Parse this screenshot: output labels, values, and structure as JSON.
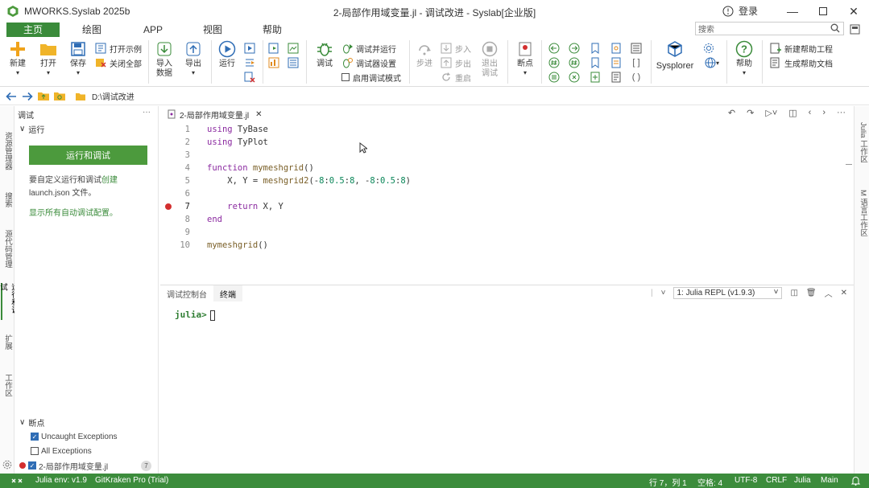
{
  "titlebar": {
    "app_title": "MWORKS.Syslab 2025b",
    "doc_title": "2-局部作用域变量.jl - 调试改进 - Syslab[企业版]",
    "login": "登录"
  },
  "ribbon_tabs": [
    "主页",
    "绘图",
    "APP",
    "视图",
    "帮助"
  ],
  "search": {
    "placeholder": "搜索"
  },
  "ribbon": {
    "new": "新建",
    "open": "打开",
    "save": "保存",
    "open_example": "打开示例",
    "close_all": "关闭全部",
    "import_data": "导入\n数据",
    "export": "导出",
    "run": "运行",
    "debug": "调试",
    "debug_run_to": "调试并运行",
    "debugger_settings": "调试器设置",
    "just_my_code": "启用调试模式",
    "step": "步进",
    "step_in": "步入",
    "step_out": "步出",
    "restart": "重启",
    "exit_debug": "退出\n调试",
    "breakpoints": "断点",
    "sysplorer": "Sysplorer",
    "help": "帮助",
    "new_help_project": "新建帮助工程",
    "gen_help_doc": "生成帮助文档"
  },
  "pathbar": {
    "path": "D:\\调试改进"
  },
  "activity_tabs": [
    "资源管理器",
    "搜索",
    "源代码管理",
    "运行和调试",
    "扩展",
    "工作区"
  ],
  "sidepanel": {
    "header": "调试",
    "section_run": "运行",
    "run_debug_button": "运行和调试",
    "text1_a": "要自定义运行和调试",
    "text1_link": "创建",
    "text1_b": "launch.json 文件。",
    "text2": "显示所有自动调试配置。",
    "section_breakpoints": "断点",
    "bp_uncaught": "Uncaught Exceptions",
    "bp_all": "All Exceptions",
    "bp_file": "2-局部作用域变量.jl",
    "bp_file_count": "7"
  },
  "editor": {
    "tab_label": "2-局部作用域变量.jl",
    "lines": [
      {
        "n": "1",
        "html": "<span class='kw'>using</span> TyBase"
      },
      {
        "n": "2",
        "html": "<span class='kw'>using</span> TyPlot"
      },
      {
        "n": "3",
        "html": ""
      },
      {
        "n": "4",
        "html": "<span class='kw'>function</span> <span class='fn'>mymeshgrid</span>()"
      },
      {
        "n": "5",
        "html": "    X, Y = <span class='fn'>meshgrid2</span>(-<span class='num'>8</span>:<span class='num'>0.5</span>:<span class='num'>8</span>, -<span class='num'>8</span>:<span class='num'>0.5</span>:<span class='num'>8</span>)"
      },
      {
        "n": "6",
        "html": ""
      },
      {
        "n": "7",
        "html": "    <span class='kw'>return</span> X, Y",
        "breakpoint": true
      },
      {
        "n": "8",
        "html": "<span class='kw'>end</span>"
      },
      {
        "n": "9",
        "html": ""
      },
      {
        "n": "10",
        "html": "<span class='fn'>mymeshgrid</span>()"
      }
    ]
  },
  "panel": {
    "tabs": [
      "调试控制台",
      "终端"
    ],
    "terminal_select": "1: Julia REPL (v1.9.3)",
    "prompt": "julia>"
  },
  "right_tabs": [
    "Julia 工作区",
    "M 语言工作区"
  ],
  "status": {
    "env": "Julia env: v1.9",
    "gitkraken": "GitKraken Pro (Trial)",
    "cursor_pos": "行 7，列 1",
    "spaces": "空格: 4",
    "encoding": "UTF-8",
    "eol": "CRLF",
    "language": "Julia",
    "branch": "Main"
  }
}
